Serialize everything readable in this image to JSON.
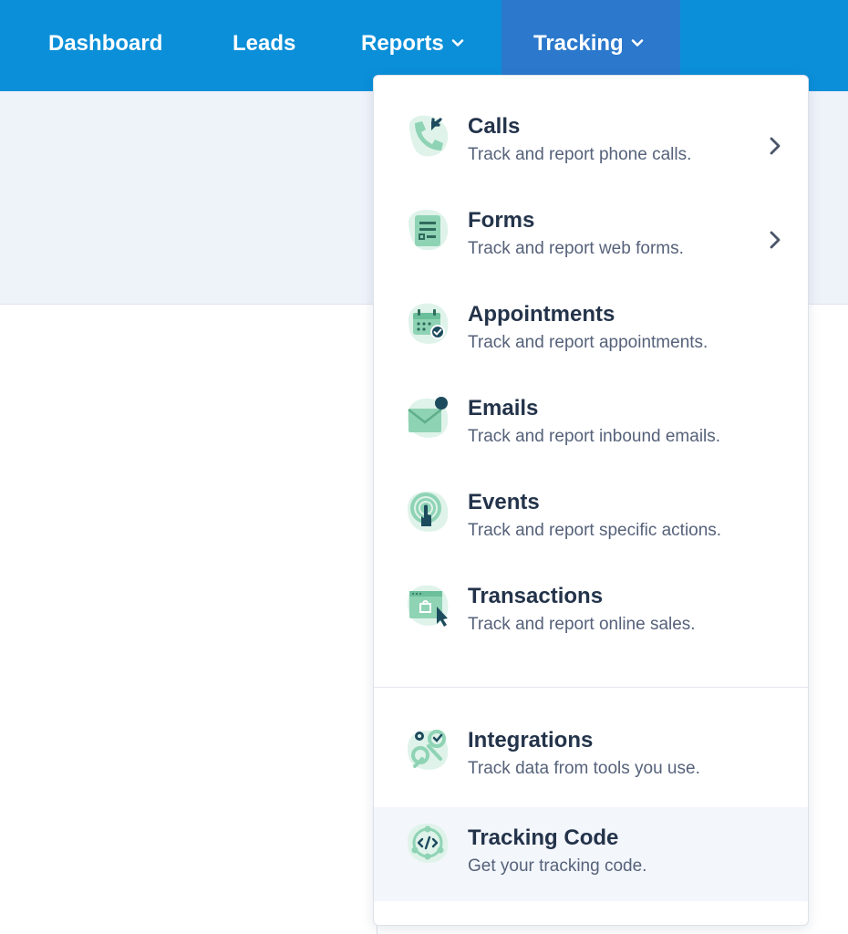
{
  "nav": {
    "dashboard": "Dashboard",
    "leads": "Leads",
    "reports": "Reports",
    "tracking": "Tracking"
  },
  "dropdown": {
    "items": [
      {
        "title": "Calls",
        "desc": "Track and report phone calls.",
        "icon": "phone-icon"
      },
      {
        "title": "Forms",
        "desc": "Track and report web forms.",
        "icon": "form-icon"
      },
      {
        "title": "Appointments",
        "desc": "Track and report appointments.",
        "icon": "calendar-icon"
      },
      {
        "title": "Emails",
        "desc": "Track and report inbound emails.",
        "icon": "envelope-icon"
      },
      {
        "title": "Events",
        "desc": "Track and report specific actions.",
        "icon": "click-target-icon"
      },
      {
        "title": "Transactions",
        "desc": "Track and report online sales.",
        "icon": "shopping-bag-icon"
      },
      {
        "title": "Integrations",
        "desc": "Track data from tools you use.",
        "icon": "gears-icon"
      },
      {
        "title": "Tracking Code",
        "desc": "Get your tracking code.",
        "icon": "code-icon"
      }
    ]
  },
  "colors": {
    "nav_bg": "#0b8fd8",
    "nav_active_bg": "#2b78cc",
    "icon_green": "#8fd3b5",
    "icon_dark": "#1d4b5e",
    "title_text": "#23334a",
    "desc_text": "#56627a"
  }
}
